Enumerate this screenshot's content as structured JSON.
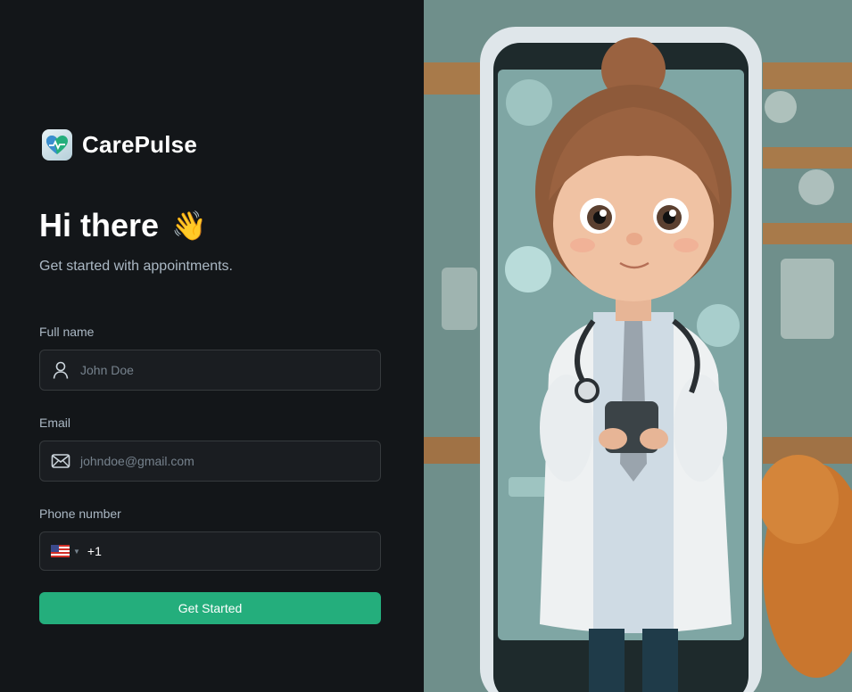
{
  "brand": {
    "name": "CarePulse",
    "logo_icon": "heart-pulse-icon"
  },
  "header": {
    "title": "Hi there",
    "emoji": "👋",
    "subtitle": "Get started with appointments."
  },
  "form": {
    "full_name": {
      "label": "Full name",
      "placeholder": "John Doe",
      "icon": "user-icon"
    },
    "email": {
      "label": "Email",
      "placeholder": "johndoe@gmail.com",
      "icon": "mail-icon"
    },
    "phone": {
      "label": "Phone number",
      "country_code": "+1",
      "country": "US"
    },
    "submit_label": "Get Started"
  },
  "colors": {
    "background": "#131619",
    "accent": "#24ae7c",
    "input_bg": "#1a1d21",
    "input_border": "#363a3d"
  }
}
